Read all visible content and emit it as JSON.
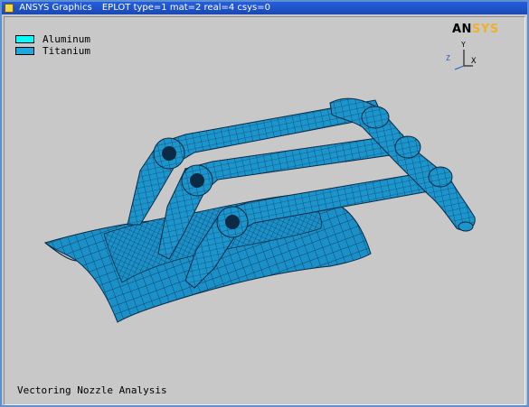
{
  "window": {
    "title": "ANSYS Graphics",
    "info": "EPLOT  type=1 mat=2 real=4 csys=0"
  },
  "legend": {
    "items": [
      {
        "label": "Aluminum",
        "color": "#00ffff"
      },
      {
        "label": "Titanium",
        "color": "#1fa7e0"
      }
    ]
  },
  "logo": {
    "part1": "AN",
    "part2": "SYS"
  },
  "triad": {
    "x": "X",
    "y": "Y",
    "z": "Z"
  },
  "viewport": {
    "caption": "Vectoring Nozzle Analysis"
  },
  "colors": {
    "mesh_fill": "#1b90c8",
    "mesh_line": "#0a2b45",
    "background": "#c8c8c8"
  }
}
